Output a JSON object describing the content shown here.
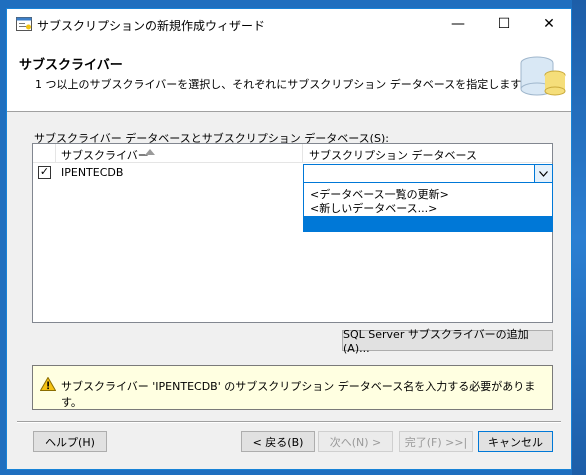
{
  "window": {
    "title": "サブスクリプションの新規作成ウィザード",
    "minimize_glyph": "—",
    "maximize_glyph": "☐",
    "close_glyph": "✕"
  },
  "header": {
    "title": "サブスクライバー",
    "subtitle": "1 つ以上のサブスクライバーを選択し、それぞれにサブスクリプション データベースを指定します。"
  },
  "grid": {
    "label": "サブスクライバー データベースとサブスクリプション データベース(S):",
    "columns": [
      "サブスクライバー",
      "サブスクリプション データベース"
    ],
    "rows": [
      {
        "checked": true,
        "check_glyph": "✓",
        "subscriber": "IPENTECDB",
        "database": ""
      }
    ],
    "dropdown_options": [
      "<データベース一覧の更新>",
      "<新しいデータベース...>",
      ""
    ]
  },
  "add_subscriber_button": "SQL Server サブスクライバーの追加(A)...",
  "message": "サブスクライバー 'IPENTECDB' のサブスクリプション データベース名を入力する必要があります。",
  "footer": {
    "help": "ヘルプ(H)",
    "back": "< 戻る(B)",
    "next": "次へ(N) >",
    "finish": "完了(F) >>|",
    "cancel": "キャンセル"
  },
  "colors": {
    "accent": "#0078d7",
    "message_background": "#ffffe1",
    "warning": "#f5c211"
  },
  "icons": {
    "title": "wizard-app-icon",
    "header": "database-graphic",
    "sort": "sort-ascending-icon",
    "combo": "chevron-down-icon",
    "warning": "warning-icon"
  }
}
